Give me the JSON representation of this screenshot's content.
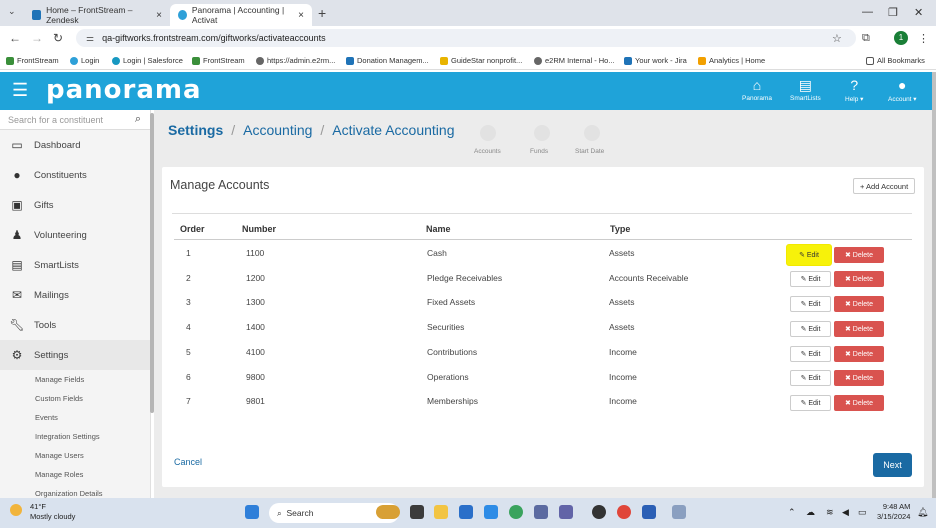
{
  "browser": {
    "tabs": [
      {
        "title": "Home – FrontStream – Zendesk"
      },
      {
        "title": "Panorama | Accounting | Activat"
      }
    ],
    "url": "qa-giftworks.frontstream.com/giftworks/activateaccounts",
    "bookmarks": [
      "FrontStream",
      "Login",
      "Login | Salesforce",
      "FrontStream",
      "https://admin.e2rm...",
      "Donation Managem...",
      "GuideStar nonprofit...",
      "e2RM Internal - Ho...",
      "Your work - Jira",
      "Analytics | Home"
    ],
    "all_bookmarks": "All Bookmarks",
    "profile_initial": "1"
  },
  "header": {
    "logo": "panorama",
    "nav": [
      {
        "label": "Panorama",
        "icon": "home-icon"
      },
      {
        "label": "SmartLists",
        "icon": "list-icon"
      },
      {
        "label": "Help ▾",
        "icon": "help-icon"
      },
      {
        "label": "Account ▾",
        "icon": "user-icon"
      }
    ],
    "accent": "#1fa3d9"
  },
  "sidebar": {
    "search_placeholder": "Search for a constituent",
    "items": [
      {
        "label": "Dashboard"
      },
      {
        "label": "Constituents"
      },
      {
        "label": "Gifts"
      },
      {
        "label": "Volunteering"
      },
      {
        "label": "SmartLists"
      },
      {
        "label": "Mailings"
      },
      {
        "label": "Tools"
      },
      {
        "label": "Settings"
      }
    ],
    "sub_items": [
      "Manage Fields",
      "Custom Fields",
      "Events",
      "Integration Settings",
      "Manage Users",
      "Manage Roles",
      "Organization Details"
    ]
  },
  "breadcrumb": {
    "root": "Settings",
    "level1": "Accounting",
    "level2": "Activate Accounting"
  },
  "steps": [
    "Accounts",
    "Funds",
    "Start Date"
  ],
  "card": {
    "title": "Manage Accounts",
    "add_label": "+ Add Account",
    "columns": [
      "Order",
      "Number",
      "Name",
      "Type"
    ],
    "rows": [
      {
        "order": "1",
        "number": "1100",
        "name": "Cash",
        "type": "Assets"
      },
      {
        "order": "2",
        "number": "1200",
        "name": "Pledge Receivables",
        "type": "Accounts Receivable"
      },
      {
        "order": "3",
        "number": "1300",
        "name": "Fixed Assets",
        "type": "Assets"
      },
      {
        "order": "4",
        "number": "1400",
        "name": "Securities",
        "type": "Assets"
      },
      {
        "order": "5",
        "number": "4100",
        "name": "Contributions",
        "type": "Income"
      },
      {
        "order": "6",
        "number": "9800",
        "name": "Operations",
        "type": "Income"
      },
      {
        "order": "7",
        "number": "9801",
        "name": "Memberships",
        "type": "Income"
      }
    ],
    "edit_label": "Edit",
    "delete_label": "Delete",
    "cancel_label": "Cancel",
    "next_label": "Next"
  },
  "taskbar": {
    "temp": "41°F",
    "weather": "Mostly cloudy",
    "search_label": "Search",
    "time": "9:48 AM",
    "date": "3/15/2024"
  }
}
